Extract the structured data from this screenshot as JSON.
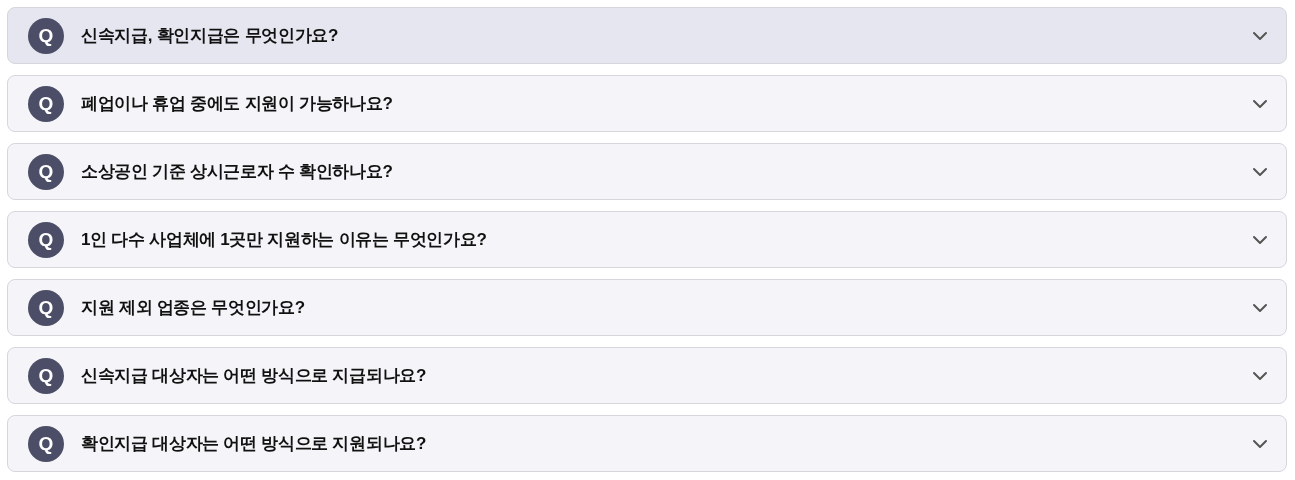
{
  "faq": [
    {
      "badge": "Q",
      "question": "신속지급, 확인지급은 무엇인가요?",
      "selected": true,
      "expanded": false
    },
    {
      "badge": "Q",
      "question": "폐업이나 휴업 중에도 지원이 가능하나요?",
      "selected": false,
      "expanded": false
    },
    {
      "badge": "Q",
      "question": "소상공인 기준 상시근로자 수 확인하나요?",
      "selected": false,
      "expanded": false
    },
    {
      "badge": "Q",
      "question": "1인 다수 사업체에 1곳만 지원하는 이유는 무엇인가요?",
      "selected": false,
      "expanded": false
    },
    {
      "badge": "Q",
      "question": "지원 제외 업종은 무엇인가요?",
      "selected": false,
      "expanded": false
    },
    {
      "badge": "Q",
      "question": "신속지급 대상자는 어떤 방식으로 지급되나요?",
      "selected": false,
      "expanded": false
    },
    {
      "badge": "Q",
      "question": "확인지급 대상자는 어떤 방식으로 지원되나요?",
      "selected": false,
      "expanded": false
    }
  ]
}
